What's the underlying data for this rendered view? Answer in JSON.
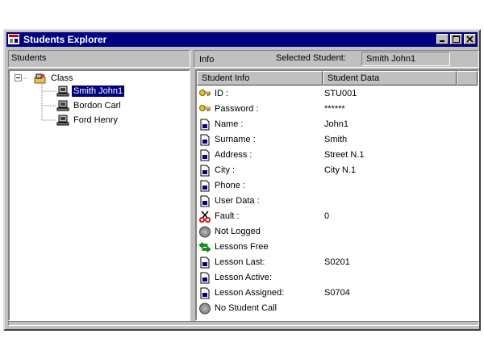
{
  "window": {
    "title": "Students Explorer"
  },
  "left_header": "Students",
  "right_header": {
    "info_label": "Info",
    "selected_label": "Selected Student:",
    "selected_value": "Smith John1"
  },
  "tree": {
    "root": "Class",
    "children": [
      "Smith John1",
      "Bordon Carl",
      "Ford Henry"
    ],
    "selected_index": 0
  },
  "columns": [
    "Student Info",
    "Student Data"
  ],
  "rows": [
    {
      "icon": "key-icon",
      "field": "ID :",
      "value": "STU001"
    },
    {
      "icon": "key-icon",
      "field": "Password :",
      "value": "******"
    },
    {
      "icon": "document-icon",
      "field": "Name :",
      "value": "John1"
    },
    {
      "icon": "document-icon",
      "field": "Surname :",
      "value": "Smith"
    },
    {
      "icon": "document-icon",
      "field": "Address :",
      "value": "Street N.1"
    },
    {
      "icon": "document-icon",
      "field": "City :",
      "value": "City N.1"
    },
    {
      "icon": "document-icon",
      "field": "Phone :",
      "value": ""
    },
    {
      "icon": "document-icon",
      "field": "User Data :",
      "value": ""
    },
    {
      "icon": "scissors-icon",
      "field": "Fault :",
      "value": "0"
    },
    {
      "icon": "status-circle-icon",
      "field": "Not Logged",
      "value": ""
    },
    {
      "icon": "arrows-icon",
      "field": "Lessons Free",
      "value": ""
    },
    {
      "icon": "document-icon",
      "field": "Lesson Last:",
      "value": "S0201"
    },
    {
      "icon": "document-icon",
      "field": "Lesson Active:",
      "value": ""
    },
    {
      "icon": "document-icon",
      "field": "Lesson Assigned:",
      "value": "S0704"
    },
    {
      "icon": "status-circle-icon",
      "field": "No Student Call",
      "value": ""
    }
  ],
  "colors": {
    "title_bar": "#000080",
    "face": "#c0c0c0",
    "selection": "#000080"
  }
}
